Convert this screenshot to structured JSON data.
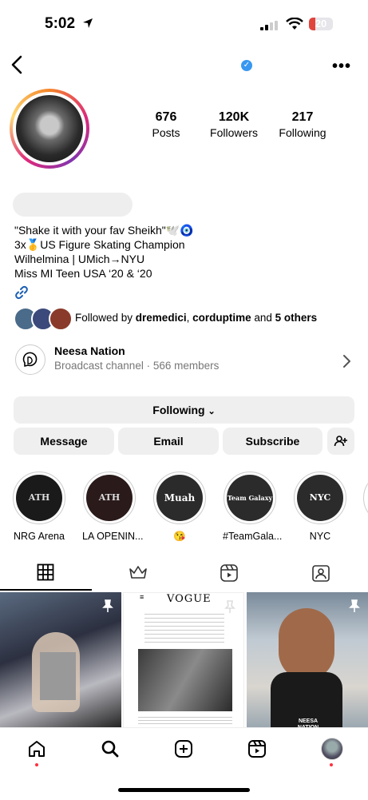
{
  "status": {
    "time": "5:02",
    "battery": "20"
  },
  "profile": {
    "posts_count": "676",
    "posts_label": "Posts",
    "followers_count": "120K",
    "followers_label": "Followers",
    "following_count": "217",
    "following_label": "Following"
  },
  "bio": {
    "line1": "\"Shake it with your fav Sheikh\"🕊️🧿",
    "line2": "3x🥇US Figure Skating Champion",
    "line3": "Wilhelmina | UMich→NYU",
    "line4": "Miss MI Teen USA ‘20 & ‘20"
  },
  "followed_by": {
    "prefix": "Followed by ",
    "name1": "dremedici",
    "sep": ", ",
    "name2": "corduptime",
    "and": " and ",
    "others": "5 others"
  },
  "channel": {
    "title": "Neesa Nation",
    "subtitle": "Broadcast channel · 566 members"
  },
  "actions": {
    "following": "Following",
    "message": "Message",
    "email": "Email",
    "subscribe": "Subscribe"
  },
  "highlights": [
    {
      "label": "NRG Arena",
      "cover": "ATH"
    },
    {
      "label": "LA OPENIN...",
      "cover": "ATH"
    },
    {
      "label": "😘",
      "cover": "Muah"
    },
    {
      "label": "#TeamGala...",
      "cover": "Team Galaxy U"
    },
    {
      "label": "NYC",
      "cover": "NYC"
    }
  ],
  "grid": {
    "post2_masthead": "VOGUE",
    "post3_caption": "NEESA NATION"
  },
  "icons": [
    "back-icon",
    "verified-icon",
    "more-icon",
    "link-icon",
    "broadcast-icon",
    "chevron-right-icon",
    "add-person-icon",
    "grid-icon",
    "crown-icon",
    "reels-icon",
    "tagged-icon",
    "home-icon",
    "search-icon",
    "create-icon",
    "reels-nav-icon"
  ],
  "colors": {
    "accent": "#3897f0",
    "notification": "#ff3040",
    "button_bg": "#efefef"
  }
}
